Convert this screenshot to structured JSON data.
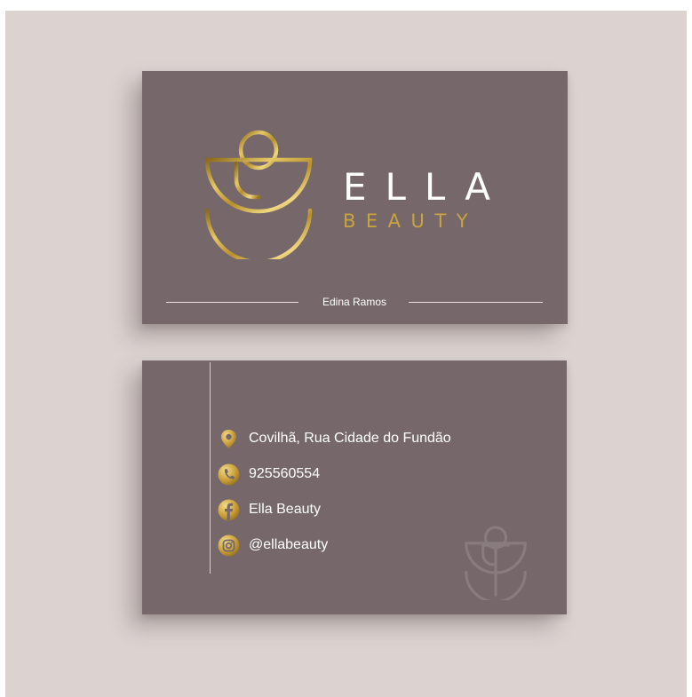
{
  "front": {
    "brand_name": "ELLA",
    "brand_sub": "BEAUTY",
    "holder_name": "Edina Ramos"
  },
  "back": {
    "contacts": [
      {
        "icon": "location-pin-icon",
        "text": "Covilhã, Rua Cidade do Fundão"
      },
      {
        "icon": "phone-icon",
        "text": "925560554"
      },
      {
        "icon": "facebook-icon",
        "text": "Ella Beauty"
      },
      {
        "icon": "instagram-icon",
        "text": "@ellabeauty"
      }
    ]
  },
  "colors": {
    "backdrop": "#dcd3d1",
    "card": "#75676a",
    "gold": "#c9a43e",
    "text": "#ffffff"
  }
}
